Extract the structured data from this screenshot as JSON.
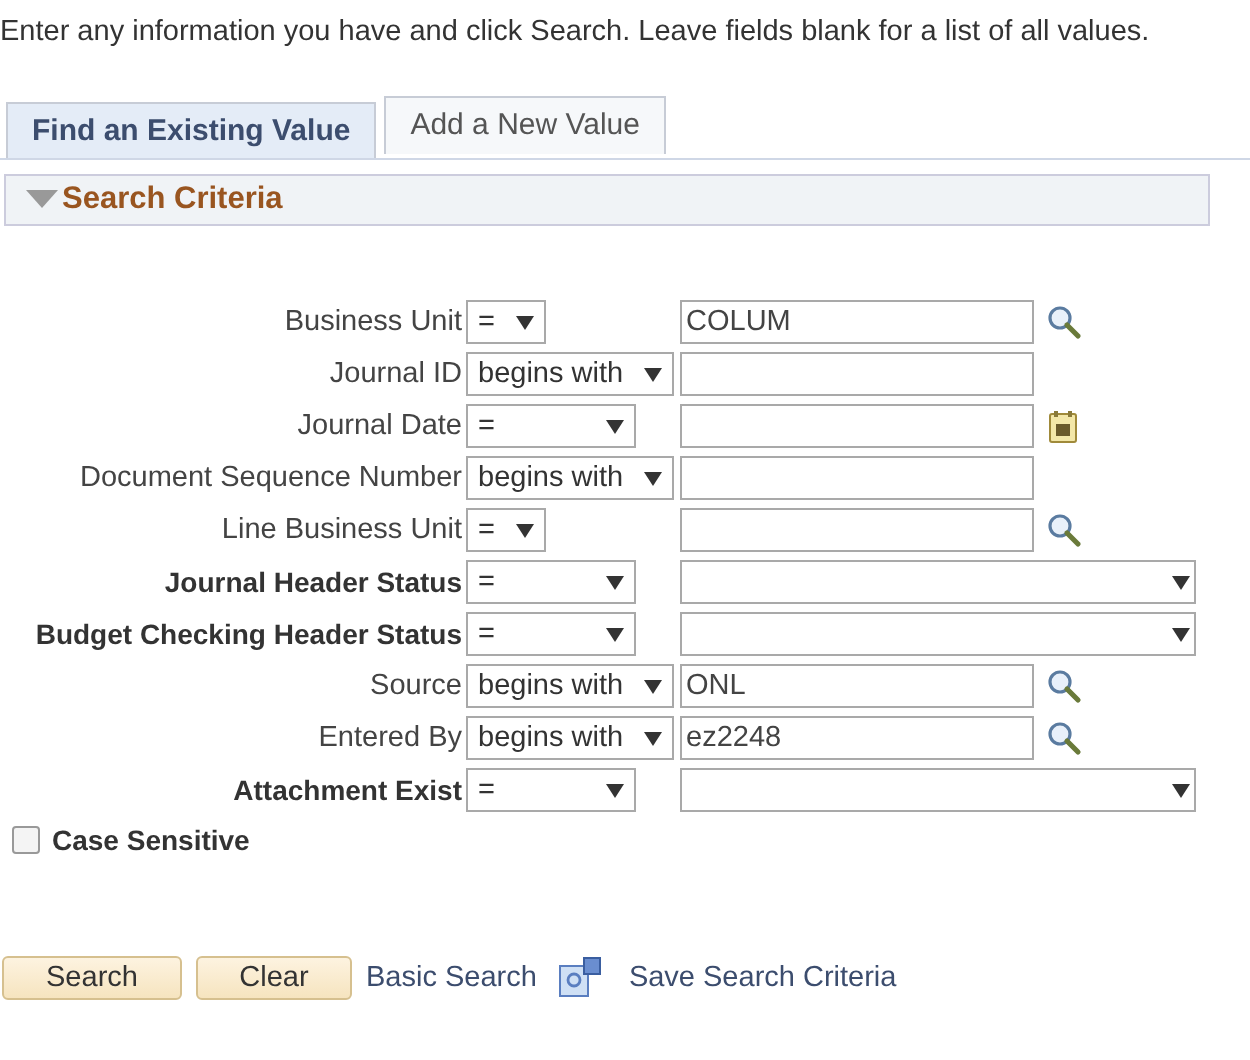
{
  "instructions": "Enter any information you have and click Search. Leave fields blank for a list of all values.",
  "tabs": [
    {
      "label": "Find an Existing Value",
      "selected": true
    },
    {
      "label": "Add a New Value",
      "selected": false
    }
  ],
  "section": {
    "title": "Search Criteria",
    "expanded": true
  },
  "fields": [
    {
      "label": "Business Unit",
      "bold": false,
      "operator": "=",
      "kind": "code",
      "value": "COLUM"
    },
    {
      "label": "Journal ID",
      "bold": false,
      "operator": "begins with",
      "kind": "text"
    },
    {
      "label": "Journal Date",
      "bold": false,
      "operator": "=",
      "kind": "date"
    },
    {
      "label": "Document Sequence Number",
      "bold": false,
      "operator": "begins with",
      "kind": "text"
    },
    {
      "label": "Line Business Unit",
      "bold": false,
      "operator": "=",
      "kind": "code"
    },
    {
      "label": "Journal Header Status",
      "bold": true,
      "operator": "=",
      "kind": "status"
    },
    {
      "label": "Budget Checking Header Status",
      "bold": true,
      "operator": "=",
      "kind": "status"
    },
    {
      "label": "Source",
      "bold": false,
      "operator": "begins with",
      "kind": "prompt",
      "value": "ONL"
    },
    {
      "label": "Entered By",
      "bold": false,
      "operator": "begins with",
      "kind": "prompt",
      "value": "ez2248"
    },
    {
      "label": "Attachment Exist",
      "bold": true,
      "operator": "=",
      "kind": "status"
    }
  ],
  "case_sensitive": {
    "label": "Case Sensitive",
    "checked": false
  },
  "buttons": [
    "Search",
    "Clear"
  ],
  "links": [
    "Basic Search",
    "Save Search Criteria"
  ]
}
